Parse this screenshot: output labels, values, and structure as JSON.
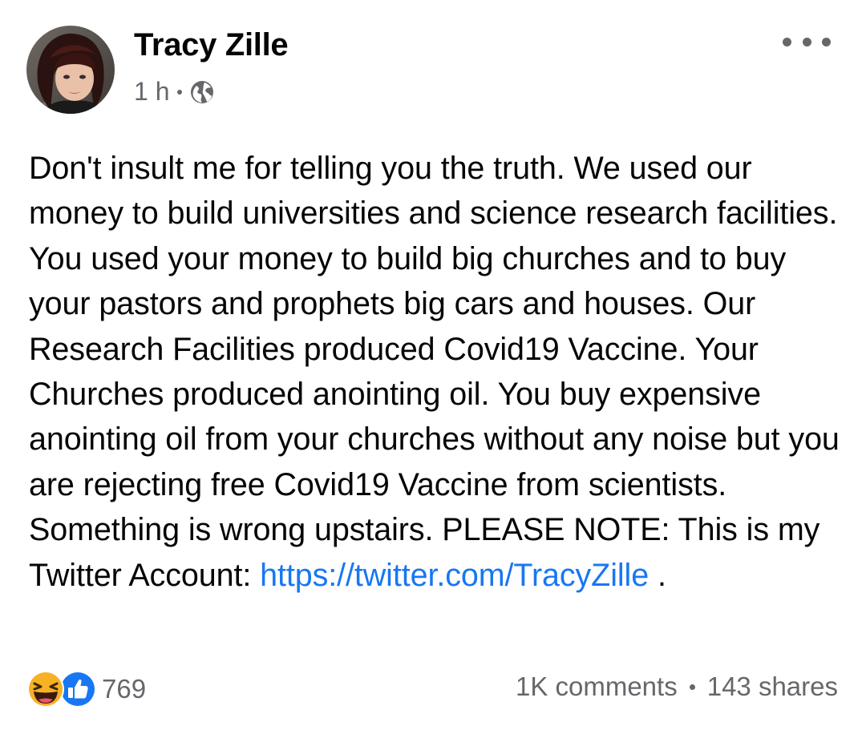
{
  "post": {
    "author_name": "Tracy Zille",
    "timestamp": "1 h",
    "audience_icon": "globe-icon",
    "menu_icon": "more-horizontal-icon",
    "text_main": "Don't insult me for telling you the truth. We used our money to build universities and science research facilities. You used your money to build big churches and to buy your pastors and prophets big cars and houses. Our Research Facilities produced Covid19 Vaccine. Your Churches produced anointing oil. You buy expensive anointing oil from your churches without any noise but you are rejecting free Covid19 Vaccine from scientists. Something is wrong upstairs. PLEASE NOTE: This is my Twitter Account: ",
    "link_text": "https://twitter.com/TracyZille",
    "text_end": " ."
  },
  "footer": {
    "reaction_icons": [
      "haha-icon",
      "like-icon"
    ],
    "reaction_count": "769",
    "comments": "1K comments",
    "shares": "143 shares"
  },
  "colors": {
    "link": "#1877f2",
    "secondary_text": "#65676b",
    "like_blue": "#1877f2",
    "haha_yellow": "#f7b125"
  }
}
